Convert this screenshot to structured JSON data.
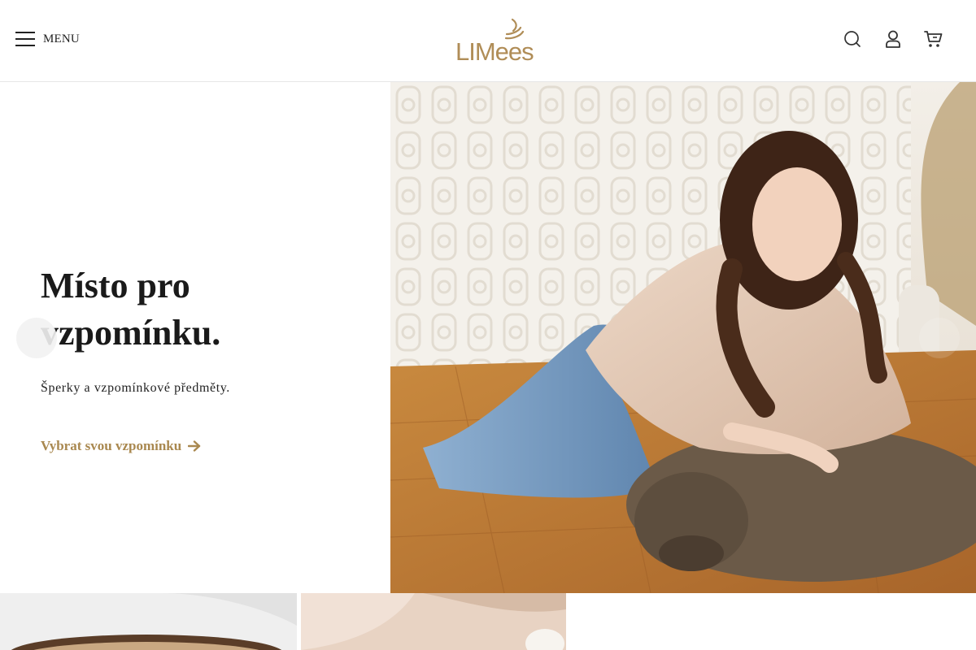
{
  "header": {
    "menu_label": "MENU",
    "logo_text": "LIMees",
    "icons": [
      "search-icon",
      "user-icon",
      "cart-icon"
    ]
  },
  "hero": {
    "title_line1": "Místo pro",
    "title_line2": "vzpomínku. ",
    "subtitle": "Šperky a vzpomínkové předměty.",
    "cta_label": "Vybrat svou vzpomínku",
    "accent_color": "#a9884f"
  },
  "colors": {
    "brand": "#b08d57",
    "text": "#1a1a1a"
  }
}
